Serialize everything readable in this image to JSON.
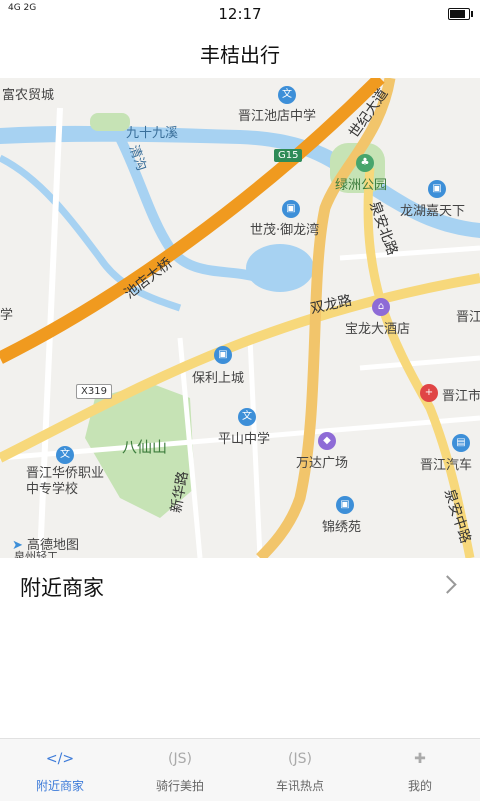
{
  "status": {
    "network": "4G 2G",
    "time": "12:17",
    "battery_level": 0.85
  },
  "title": "丰桔出行",
  "map": {
    "labels": {
      "fuyu": "富农贸城",
      "jinjiang_school": "晋江池店中学",
      "shijidadao": "世纪大道",
      "jiushijiuxi": "九十九溪",
      "qinggou": "清沟",
      "g15": "G15",
      "lvzhou": "绿洲公园",
      "shimao": "世茂·御龙湾",
      "longhu": "龙湖嘉天下",
      "quanan_north": "泉安北路",
      "chidian_bridge": "池店大桥",
      "shuanglong": "双龙路",
      "baolong": "宝龙大酒店",
      "jinjiang_right": "晋江",
      "xue": "学",
      "poly": "保利上城",
      "x319": "X319",
      "baxianshan": "八仙山",
      "jinjiang_red": "晋江市",
      "pingshan": "平山中学",
      "wanda": "万达广场",
      "jinjiang_auto": "晋江汽车",
      "huaqiao": "晋江华侨职业中专学校",
      "xinhuqian": "新华路",
      "jinxiu": "锦绣苑",
      "quanan_mid": "泉安中路",
      "amap": "高德地图",
      "quanzhou_light": "泉州轻工"
    }
  },
  "nearby": {
    "label": "附近商家"
  },
  "tabs": [
    {
      "icon": "</>",
      "label": "附近商家"
    },
    {
      "icon": "(JS)",
      "label": "骑行美拍"
    },
    {
      "icon": "(JS)",
      "label": "车讯热点"
    },
    {
      "icon": "✚",
      "label": "我的"
    }
  ]
}
